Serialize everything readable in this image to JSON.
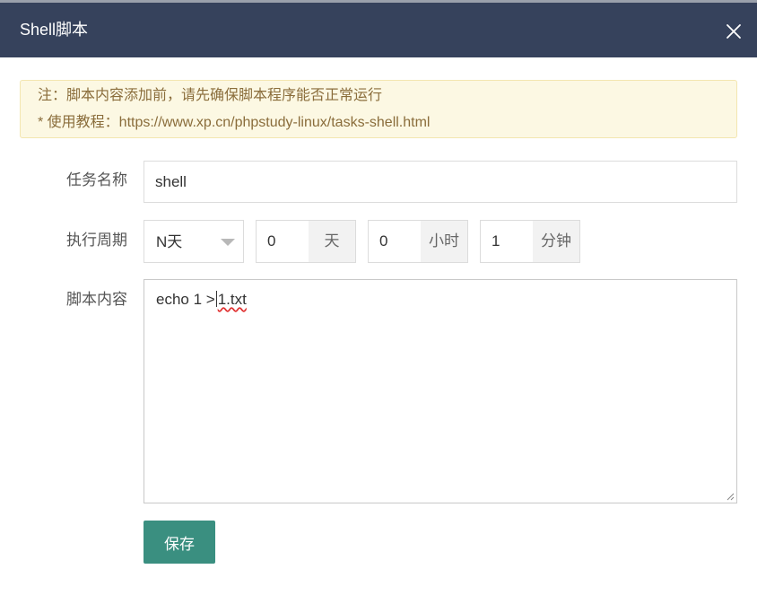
{
  "dialog": {
    "title": "Shell脚本",
    "close_icon": "close-icon"
  },
  "notice": {
    "line1": "注：脚本内容添加前，请先确保脚本程序能否正常运行",
    "line2": "* 使用教程：https://www.xp.cn/phpstudy-linux/tasks-shell.html"
  },
  "form": {
    "task_name": {
      "label": "任务名称",
      "value": "shell"
    },
    "period": {
      "label": "执行周期",
      "type_value": "N天",
      "days": {
        "value": "0",
        "unit": "天"
      },
      "hours": {
        "value": "0",
        "unit": "小时"
      },
      "minutes": {
        "value": "1",
        "unit": "分钟"
      }
    },
    "script": {
      "label": "脚本内容",
      "before_cursor": "echo 1 >",
      "after_cursor": "1.txt"
    },
    "save_label": "保存"
  },
  "colors": {
    "header_bg": "#36425c",
    "notice_bg": "#fcf8e3",
    "notice_text": "#8a6d3b",
    "primary_button": "#3a8f80"
  }
}
